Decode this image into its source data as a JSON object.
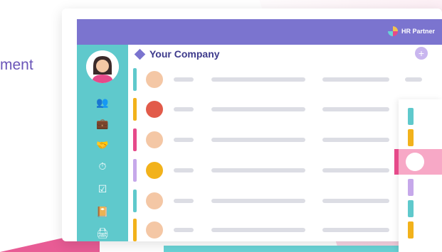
{
  "tagline": "ment",
  "app": {
    "brand": "HR Partner",
    "company": "Your Company"
  },
  "sidebar": {
    "icons": [
      "users-icon",
      "briefcase-icon",
      "handshake-icon",
      "clock-icon",
      "checkbox-icon",
      "book-icon",
      "printer-icon"
    ]
  },
  "rows": [
    {
      "bar_color": "#5fc9cc"
    },
    {
      "bar_color": "#f2b21b"
    },
    {
      "bar_color": "#e64a8a"
    },
    {
      "bar_color": "#c6a8ea"
    },
    {
      "bar_color": "#5fc9cc"
    },
    {
      "bar_color": "#f2b21b"
    }
  ],
  "colors": {
    "accent": "#7b74cf",
    "teal": "#5fc9cc",
    "pink": "#e64a8a",
    "yellow": "#f2b21b",
    "lavender": "#c6a8ea"
  }
}
